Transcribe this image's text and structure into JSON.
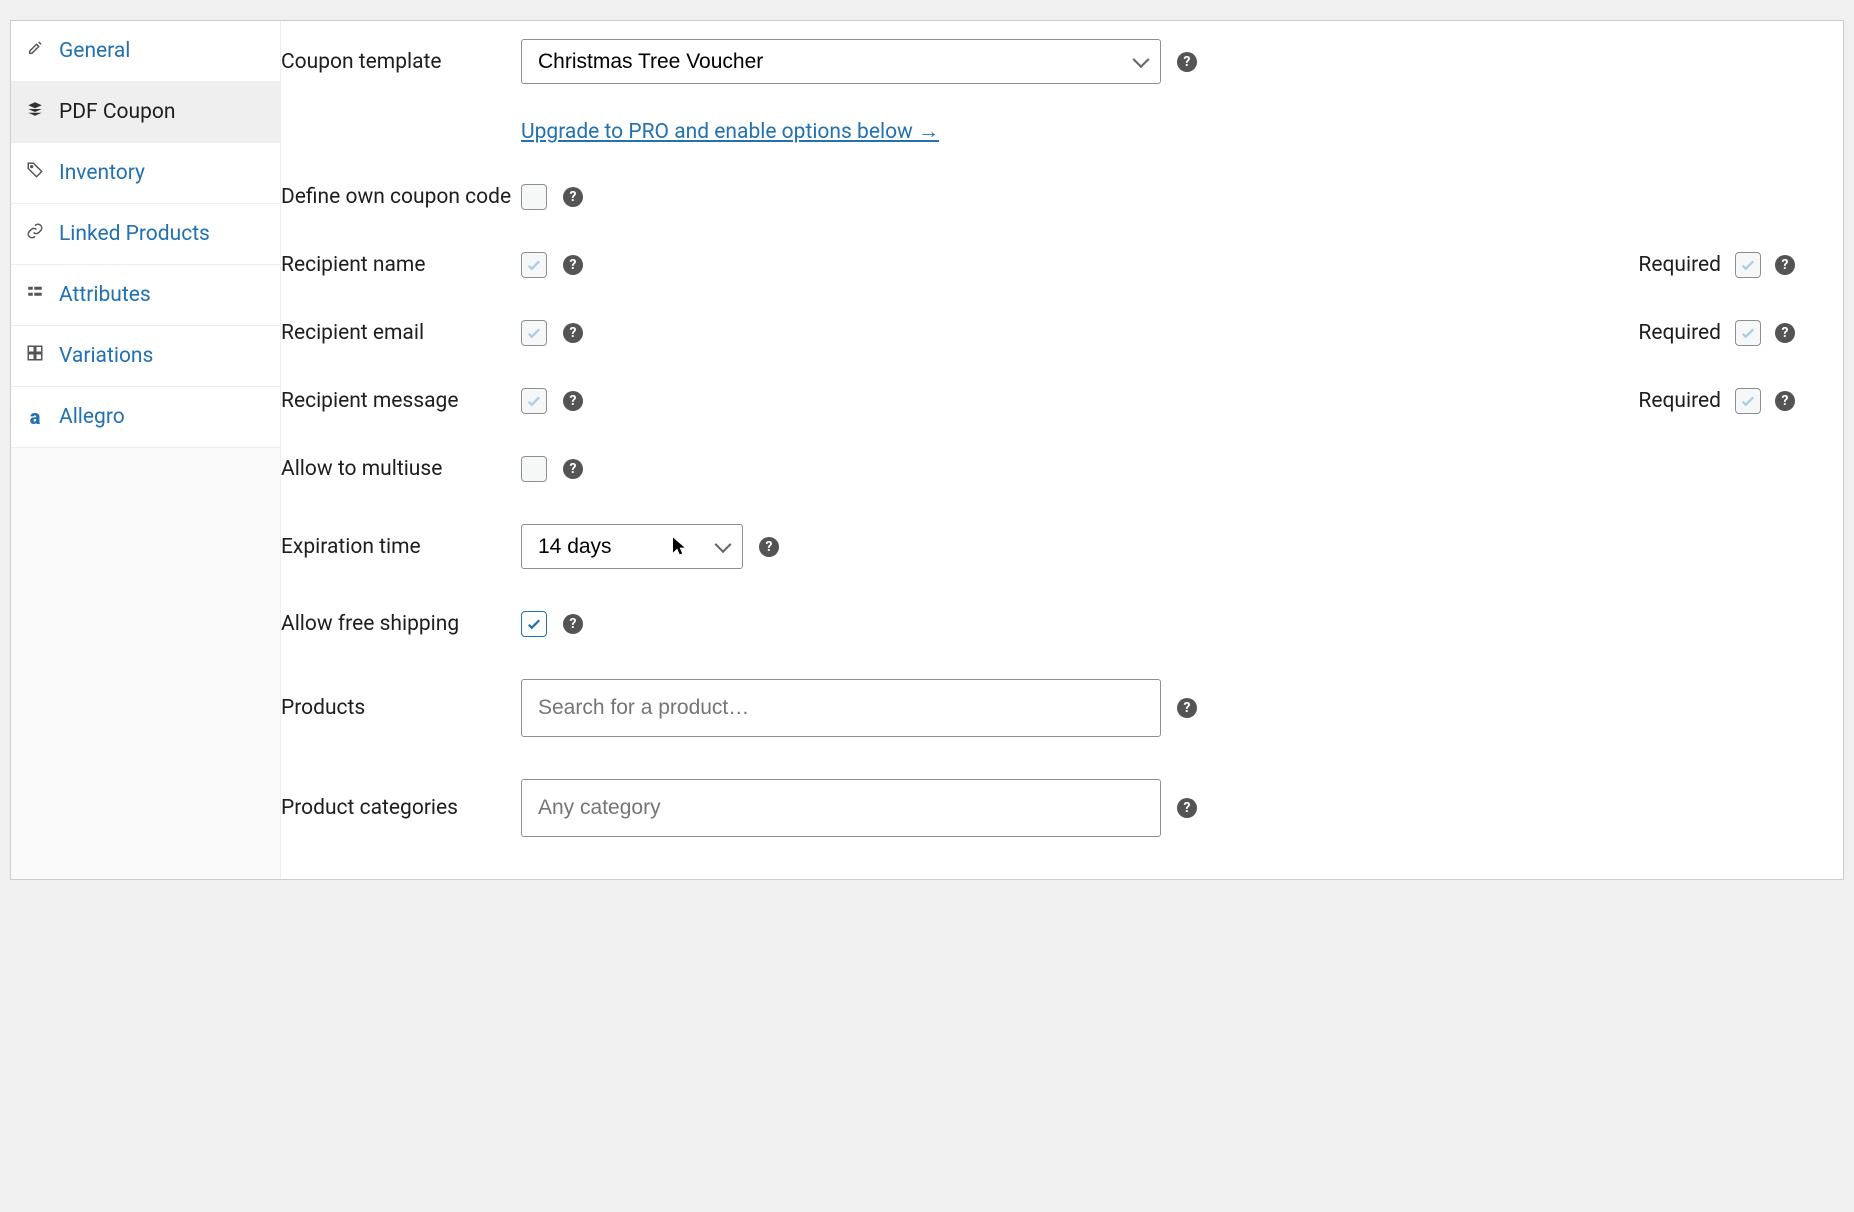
{
  "sidebar": {
    "items": [
      {
        "label": "General"
      },
      {
        "label": "PDF Coupon"
      },
      {
        "label": "Inventory"
      },
      {
        "label": "Linked Products"
      },
      {
        "label": "Attributes"
      },
      {
        "label": "Variations"
      },
      {
        "label": "Allegro"
      }
    ]
  },
  "main": {
    "coupon_template_label": "Coupon template",
    "coupon_template_value": "Christmas Tree Voucher",
    "upgrade_link": "Upgrade to PRO and enable options below →",
    "define_own_code_label": "Define own coupon code",
    "recipient_name_label": "Recipient name",
    "recipient_email_label": "Recipient email",
    "recipient_message_label": "Recipient message",
    "required_label": "Required",
    "allow_multiuse_label": "Allow to multiuse",
    "expiration_label": "Expiration time",
    "expiration_value": "14 days",
    "allow_free_shipping_label": "Allow free shipping",
    "products_label": "Products",
    "products_placeholder": "Search for a product…",
    "categories_label": "Product categories",
    "categories_placeholder": "Any category"
  }
}
